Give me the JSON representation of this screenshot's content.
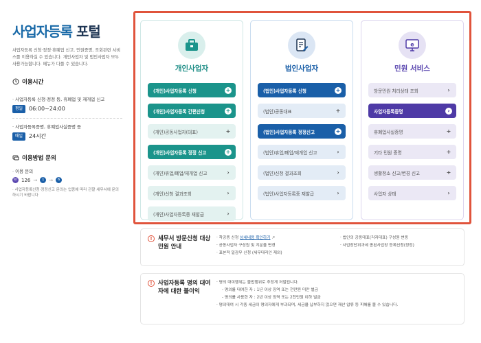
{
  "portal": {
    "title_main": "사업자등록",
    "title_sub": "포털",
    "description": "사업자등록 신청·정정·휴폐업 신고, 민원증명, 조회관련 서비스를 이용하실 수 있습니다. 개인사업자 및 법인사업자 모두 사용가능합니다. 메뉴가 다를 수 있습니다."
  },
  "hours": {
    "heading": "이용시간",
    "items": [
      {
        "text": "· 사업자등록 신청·정정 등, 휴폐업 및 재개업 신고",
        "badge": "평일",
        "time": "06:00~24:00"
      },
      {
        "text": "· 사업자등록증명, 휴폐업사실증명 등",
        "badge": "매일",
        "time": "24시간"
      }
    ]
  },
  "contact": {
    "heading": "이용방법 문의",
    "line": "· 이용 문의",
    "num1": "126",
    "num2": "1",
    "num3": "6",
    "note": "· 사업자등록신청·정정신고 문의는 업종에 따라 관할 세무서에 문의하시기 바랍니다"
  },
  "cards": {
    "personal": {
      "title": "개인사업자",
      "buttons": [
        {
          "label": "(개인)사업자등록 신청",
          "icon": "+"
        },
        {
          "label": "(개인)사업자등록 간편신청",
          "icon": "+"
        },
        {
          "label": "(개인)공동사업자(대표)",
          "icon": "+"
        },
        {
          "label": "(개인)사업자등록 정정 신고",
          "icon": "+"
        },
        {
          "label": "(개인)휴업/폐업/재개업 신고",
          "icon": "›"
        },
        {
          "label": "(개인)신청 결과조회",
          "icon": "›"
        },
        {
          "label": "(개인)사업자등록증 재발급",
          "icon": "›"
        }
      ]
    },
    "corp": {
      "title": "법인사업자",
      "buttons": [
        {
          "label": "(법인)사업자등록 신청",
          "icon": "+"
        },
        {
          "label": "(법인)공동대표",
          "icon": "+"
        },
        {
          "label": "(법인)사업자등록 정정신고",
          "icon": "+"
        },
        {
          "label": "(법인)휴업/폐업/재개업 신고",
          "icon": "›"
        },
        {
          "label": "(법인)신청 결과조회",
          "icon": "›"
        },
        {
          "label": "(법인)사업자등록증 재발급",
          "icon": "›"
        }
      ]
    },
    "civil": {
      "title": "민원 서비스",
      "buttons": [
        {
          "label": "방문민원 처리상태 조회",
          "icon": "›"
        },
        {
          "label": "사업자등록증명",
          "icon": "›"
        },
        {
          "label": "휴폐업사실증명",
          "icon": "+"
        },
        {
          "label": "기타 민원 증명",
          "icon": "+"
        },
        {
          "label": "생활정소 신고/변경 신고",
          "icon": "+"
        },
        {
          "label": "사업자 상태",
          "icon": "›"
        }
      ]
    }
  },
  "info1": {
    "title": "세무서 방문신청 대상 민원 안내",
    "left": [
      "· 착공증 신청 ",
      "· 공동사업자 구성원 및 지분율 변경",
      "· 표본적 일감무 신청 (세무대리인 제외)"
    ],
    "link": "상세내용 확인하기",
    "right": [
      "· 법인의 공동대표(각자대표) 구성원 변동",
      "· 사업장단위과세 종된사업장 등록신청(정정)"
    ]
  },
  "info2": {
    "title": "사업자등록 명의 대여자에 대한 불이익",
    "lines": [
      "· 명의 대여행위는 불법행위로 추정게 처벌됩니다.",
      "- 명의를 대여한 자 : 1년 이상 징역 또는 천만원 미만 벌금",
      "- 명의를 사용한 자 : 2년 이상 징역 또는 2천만원 이하 벌금",
      "· 명의대여 시 각종 세금이 명의자에게 부과되며, 세금을 납부하지 않으면 재산 압류 등 피해를 볼 수 있습니다."
    ]
  },
  "colors": {
    "teal": "#1b948b",
    "blue": "#1a5fa8",
    "purple": "#4e3aa6",
    "highlight": "#e0533b"
  }
}
